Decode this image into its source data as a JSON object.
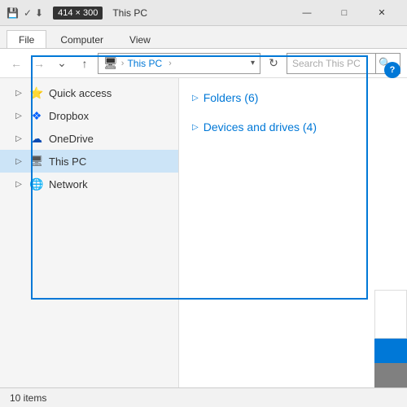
{
  "window": {
    "title": "This PC",
    "dimension_badge": "414 × 300"
  },
  "ribbon": {
    "tabs": [
      "File",
      "Computer",
      "View"
    ]
  },
  "address_bar": {
    "path": "This PC",
    "path_icon": "🖥",
    "separator": ">",
    "search_placeholder": "Search This PC"
  },
  "sidebar": {
    "items": [
      {
        "id": "quick-access",
        "label": "Quick access",
        "icon": "⭐",
        "expanded": true,
        "active": false
      },
      {
        "id": "dropbox",
        "label": "Dropbox",
        "icon": "📦",
        "expanded": false,
        "active": false
      },
      {
        "id": "onedrive",
        "label": "OneDrive",
        "icon": "☁",
        "expanded": false,
        "active": false
      },
      {
        "id": "this-pc",
        "label": "This PC",
        "icon": "💻",
        "expanded": false,
        "active": true
      },
      {
        "id": "network",
        "label": "Network",
        "icon": "🌐",
        "expanded": false,
        "active": false
      }
    ]
  },
  "main": {
    "sections": [
      {
        "id": "folders",
        "label": "Folders (6)",
        "expanded": true
      },
      {
        "id": "devices",
        "label": "Devices and drives (4)",
        "expanded": true
      }
    ]
  },
  "status_bar": {
    "item_count": "10 items"
  },
  "title_controls": {
    "minimize": "—",
    "maximize": "□",
    "close": "✕"
  }
}
